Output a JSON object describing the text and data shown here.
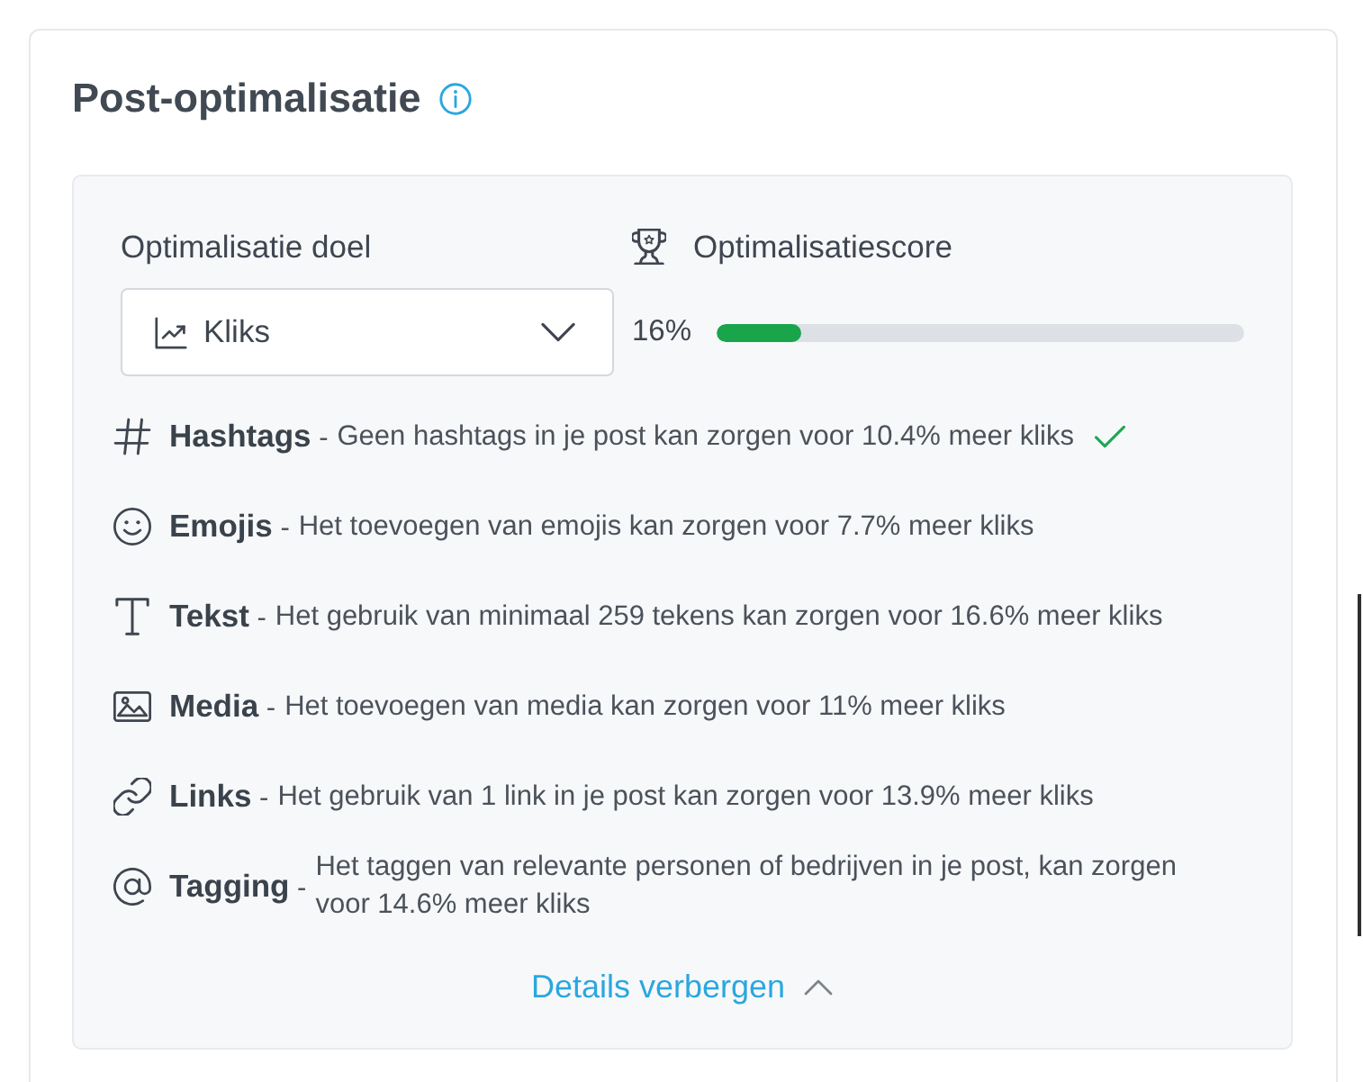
{
  "card": {
    "title": "Post-optimalisatie"
  },
  "goal": {
    "label": "Optimalisatie doel",
    "value": "Kliks"
  },
  "score": {
    "label": "Optimalisatiescore",
    "reading": "16%",
    "level": 0.16
  },
  "factors": [
    {
      "kind": "hashtags",
      "heading": "**Hashtags** -",
      "description": "Geen hashtags in je post kan zorgen voor 10.4% meer kliks",
      "achieved": true
    },
    {
      "kind": "emojis",
      "heading": "**Emojis** -",
      "description": "Het toevoegen van emojis kan zorgen voor 7.7% meer kliks",
      "achieved": false
    },
    {
      "kind": "text",
      "heading": "**Tekst** -",
      "description": "Het gebruik van minimaal 259 tekens kan zorgen voor 16.6% meer kliks",
      "achieved": false
    },
    {
      "kind": "media",
      "heading": "**Media** -",
      "description": "Het toevoegen van media kan zorgen voor 11% meer kliks",
      "achieved": false
    },
    {
      "kind": "links",
      "heading": "**Links** -",
      "description": "Het gebruik van 1 link in je post kan zorgen voor 13.9% meer kliks",
      "achieved": false
    },
    {
      "kind": "tagging",
      "heading": "**Tagging** -",
      "description": "Het taggen van relevante personen of bedrijven in je post, kan zorgen voor 14.6% meer kliks",
      "achieved": false
    }
  ],
  "toggle": {
    "label": "Details verbergen",
    "expanded": true
  }
}
